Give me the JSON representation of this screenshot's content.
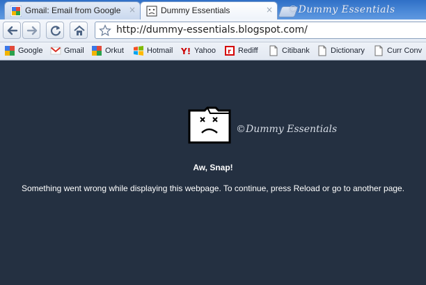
{
  "tabs": [
    {
      "title": "Gmail: Email from Google",
      "icon": "google-favicon",
      "active": false
    },
    {
      "title": "Dummy Essentials",
      "icon": "sad-page-favicon",
      "active": true
    }
  ],
  "tab_close_glyph": "×",
  "watermark": "©Dummy Essentials",
  "toolbar": {
    "url": "http://dummy-essentials.blogspot.com/"
  },
  "bookmarks": [
    {
      "label": "Google",
      "icon": "google-icon"
    },
    {
      "label": "Gmail",
      "icon": "gmail-icon"
    },
    {
      "label": "Orkut",
      "icon": "orkut-icon"
    },
    {
      "label": "Hotmail",
      "icon": "windows-icon"
    },
    {
      "label": "Yahoo",
      "icon": "yahoo-icon"
    },
    {
      "label": "Rediff",
      "icon": "rediff-icon"
    },
    {
      "label": "Citibank",
      "icon": "page-icon"
    },
    {
      "label": "Dictionary",
      "icon": "page-icon"
    },
    {
      "label": "Curr Conv",
      "icon": "page-icon"
    }
  ],
  "error": {
    "title": "Aw, Snap!",
    "message": "Something went wrong while displaying this webpage. To continue, press Reload or go to another page."
  },
  "colors": {
    "content_bg": "#243041",
    "tabstrip_blue": "#4c8ad8"
  }
}
